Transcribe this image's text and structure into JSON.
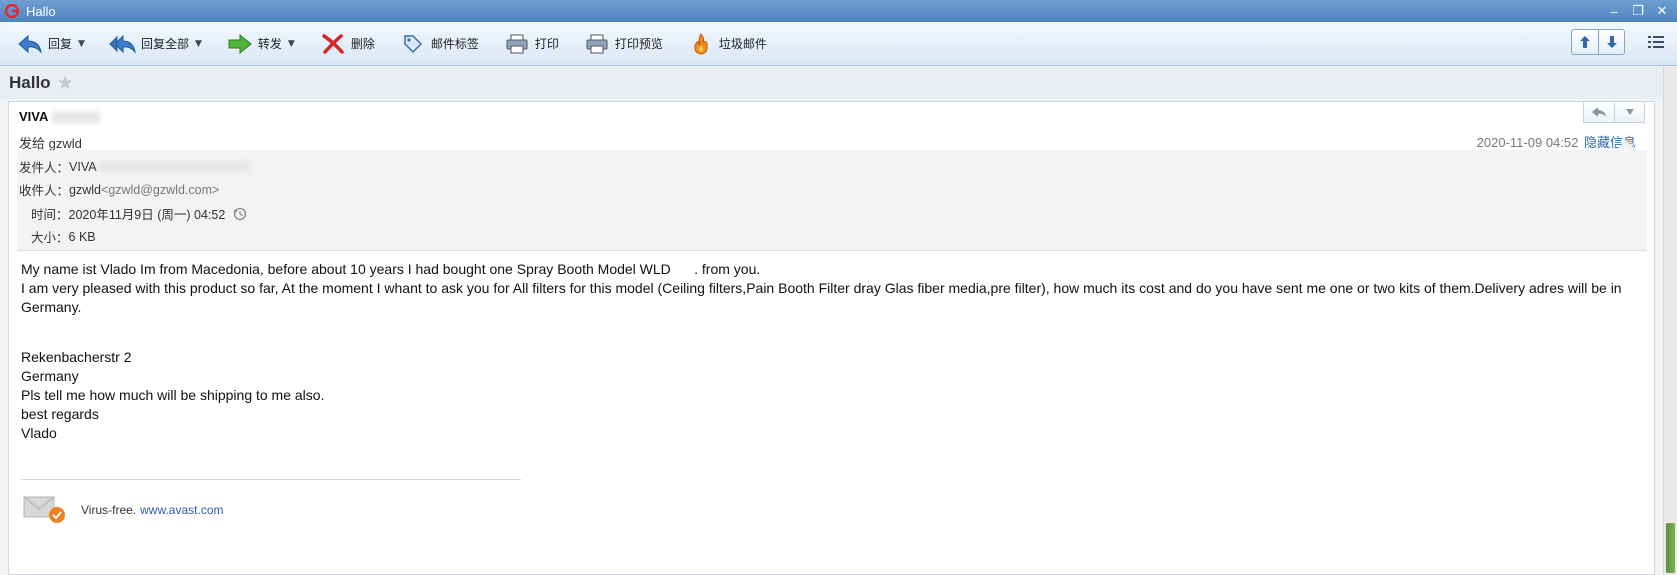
{
  "window": {
    "title": "Hallo",
    "minimize": "–",
    "restore": "❐",
    "close": "✕"
  },
  "toolbar": {
    "reply": "回复",
    "reply_all": "回复全部",
    "forward": "转发",
    "delete": "删除",
    "tags": "邮件标签",
    "print": "打印",
    "print_preview": "打印预览",
    "spam": "垃圾邮件"
  },
  "message": {
    "subject": "Hallo",
    "sender_name": "VIVA",
    "sent_to": "发给 gzwld",
    "date": "2020-11-09 04:52",
    "hide_info": "隐藏信息",
    "details": {
      "from_label": "发件人：",
      "from_value": "VIVA",
      "to_label": "收件人：",
      "to_name": "gzwld",
      "to_email": "<gzwld@gzwld.com>",
      "time_label": "时间：",
      "time_value": "2020年11月9日 (周一) 04:52",
      "size_label": "大小：",
      "size_value": "6 KB"
    },
    "body_lines": [
      "My name ist Vlado Im from Macedonia, before about 10 years I had bought one Spray Booth Model WLD      . from you.",
      "I am very pleased with this product so far, At the moment I whant to ask you for All filters for this model (Ceiling filters,Pain Booth Filter dray Glas fiber media,pre filter), how much its cost and do you have sent me one or two kits of them.Delivery adres will be in Germany."
    ],
    "address_lines": [
      "Rekenbacherstr 2",
      "Germany",
      "Pls tell me how much will be shipping to me also.",
      "best regards",
      "Vlado"
    ],
    "signature": {
      "text": "Virus-free.",
      "link": "www.avast.com"
    }
  }
}
